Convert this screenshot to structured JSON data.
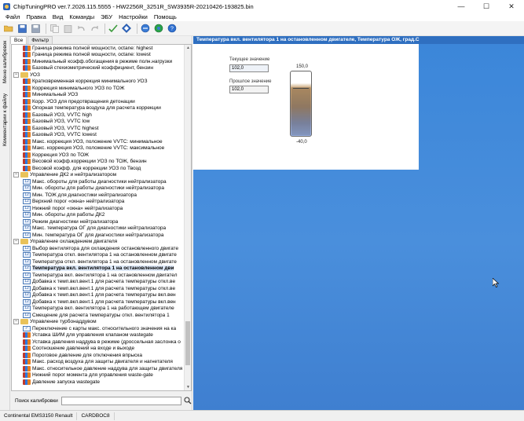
{
  "window": {
    "title": "ChipTuningPRO ver.7.2026.115.5555 - HW2256R_3251R_SW3935R-20210426-193825.bin",
    "minimize_glyph": "—",
    "maximize_glyph": "☐",
    "close_glyph": "✕"
  },
  "menu": [
    "Файл",
    "Правка",
    "Вид",
    "Команды",
    "ЭБУ",
    "Настройки",
    "Помощь"
  ],
  "toolbar": {
    "icons": [
      "open-folder-icon",
      "save-icon",
      "save-as-icon",
      "copy-icon",
      "paste-icon",
      "undo-icon",
      "redo-icon",
      "checksum-icon",
      "navigate-icon",
      "connect-icon",
      "world-icon",
      "help-icon"
    ]
  },
  "left_rail": {
    "tabs": [
      "Меню калибровок",
      "Комментарии к файлу"
    ]
  },
  "tree": {
    "tabs": [
      "Все",
      "Фильтр"
    ],
    "rows": [
      {
        "type": "map",
        "level": 2,
        "label": "Граница режима полной мощности, octane: highest"
      },
      {
        "type": "map",
        "level": 2,
        "label": "Граница режима полной мощности, octane: lowest"
      },
      {
        "type": "map",
        "level": 2,
        "label": "Минимальный коэфф.обогащения в режиме полн.нагрузки"
      },
      {
        "type": "map",
        "level": 2,
        "label": "Базовый стехиометрический коэффициент, бензин"
      },
      {
        "type": "folder",
        "level": 0,
        "label": "УОЗ",
        "exp": "−"
      },
      {
        "type": "map",
        "level": 2,
        "label": "Кратковременная коррекция минимального УОЗ"
      },
      {
        "type": "map",
        "level": 2,
        "label": "Коррекция минимального УОЗ по ТОЖ"
      },
      {
        "type": "map",
        "level": 2,
        "label": "Минимальный УОЗ"
      },
      {
        "type": "map",
        "level": 2,
        "label": "Корр. УОЗ для предотвращения детонации"
      },
      {
        "type": "map",
        "level": 2,
        "label": "Опорная температура воздуха для расчета коррекции"
      },
      {
        "type": "map",
        "level": 2,
        "label": "Базовый УОЗ, VVTC high"
      },
      {
        "type": "map",
        "level": 2,
        "label": "Базовый УОЗ, VVTC low"
      },
      {
        "type": "map",
        "level": 2,
        "label": "Базовый УОЗ, VVTC highest"
      },
      {
        "type": "map",
        "level": 2,
        "label": "Базовый УОЗ, VVTC lowest"
      },
      {
        "type": "map",
        "level": 2,
        "label": "Макс. коррекция УОЗ, положение VVTC: минимальное"
      },
      {
        "type": "map",
        "level": 2,
        "label": "Макс. коррекция УОЗ, положение VVTC: максимальное"
      },
      {
        "type": "map",
        "level": 2,
        "label": "Коррекция УОЗ по ТОЖ"
      },
      {
        "type": "map",
        "level": 2,
        "label": "Весовой коэфф.коррекции УОЗ по ТОЖ, бензин"
      },
      {
        "type": "map",
        "level": 2,
        "label": "Весовой коэфф. для коррекции УОЗ по Твозд"
      },
      {
        "type": "folder",
        "level": 0,
        "label": "Управление ДК2 и нейтрализатором",
        "exp": "−"
      },
      {
        "type": "val",
        "level": 2,
        "label": "Макс. обороты для работы диагностики нейтрализатора"
      },
      {
        "type": "val",
        "level": 2,
        "label": "Мин. обороты для работы диагностики нейтрализатора"
      },
      {
        "type": "val",
        "level": 2,
        "label": "Мин. ТОЖ для диагностики нейтрализатора"
      },
      {
        "type": "val",
        "level": 2,
        "label": "Верхний порог «окна» нейтрализатора"
      },
      {
        "type": "val",
        "level": 2,
        "label": "Нижний порог «окна» нейтрализатора"
      },
      {
        "type": "val",
        "level": 2,
        "label": "Мин. обороты для работы ДК2"
      },
      {
        "type": "val",
        "level": 2,
        "label": "Режим диагностики нейтрализатора"
      },
      {
        "type": "val",
        "level": 2,
        "label": "Макс. температура ОГ для диагностики нейтрализатора"
      },
      {
        "type": "val",
        "level": 2,
        "label": "Мин. температура ОГ для диагностики нейтрализатора"
      },
      {
        "type": "folder",
        "level": 0,
        "label": "Управление охлаждением двигателя",
        "exp": "−"
      },
      {
        "type": "val",
        "level": 2,
        "label": "Выбор вентилятора для охлаждения остановленного двигате"
      },
      {
        "type": "val",
        "level": 2,
        "label": "Температура откл. вентилятора 1 на остановленном двигате"
      },
      {
        "type": "val",
        "level": 2,
        "label": "Температура откл. вентилятора 1 на остановленном двигате"
      },
      {
        "type": "val",
        "level": 2,
        "label": "Температура вкл. вентилятора 1 на остановленном дви",
        "selected": true
      },
      {
        "type": "val",
        "level": 2,
        "label": "Температура вкл. вентилятора 1 на остановленном двигател"
      },
      {
        "type": "val",
        "level": 2,
        "label": "Добавка к темп.вкл.вент.1 для расчета температуры откл.ве"
      },
      {
        "type": "val",
        "level": 2,
        "label": "Добавка к темп.вкл.вент.1 для расчета температуры откл.ве"
      },
      {
        "type": "val",
        "level": 2,
        "label": "Добавка к темп.вкл.вент.1 для расчета температуры вкл.вен"
      },
      {
        "type": "val",
        "level": 2,
        "label": "Добавка к темп.вкл.вент.1 для расчета температуры вкл.вен"
      },
      {
        "type": "val",
        "level": 2,
        "label": "Температура вкл. вентилятора 1 на работающем двигателе"
      },
      {
        "type": "val",
        "level": 2,
        "label": "Смещение для расчета температуры откл. вентилятора 1"
      },
      {
        "type": "folder",
        "level": 0,
        "label": "Управление турбонаддувом",
        "exp": "−"
      },
      {
        "type": "check",
        "level": 2,
        "label": "Переключение с карты макс. относительного значения на ка"
      },
      {
        "type": "map",
        "level": 2,
        "label": "Уставка ШИМ для управления клапаном wastegate"
      },
      {
        "type": "map",
        "level": 2,
        "label": "Уставка давления наддува в режиме (дроссельная заслонка о"
      },
      {
        "type": "map",
        "level": 2,
        "label": "Соотношение давлений на входе и выходе"
      },
      {
        "type": "map",
        "level": 2,
        "label": "Пороговое давление для отключения впрыска"
      },
      {
        "type": "map",
        "level": 2,
        "label": "Макс. расход воздуха для защиты двигателя и нагнетателя"
      },
      {
        "type": "map",
        "level": 2,
        "label": "Макс. относительное давление наддува для защиты двигателя"
      },
      {
        "type": "map",
        "level": 2,
        "label": "Нижний порог момента для управления waste-gate"
      },
      {
        "type": "map",
        "level": 2,
        "label": "Давление запуска wastegate"
      }
    ]
  },
  "search": {
    "label": "Поиск калибровки",
    "value": "",
    "placeholder": ""
  },
  "main": {
    "header": "Температура вкл. вентилятора 1 на остановленном двигателе, Температура ОЖ, град.С",
    "current_label": "Текущее значение",
    "current_value": "102,0",
    "previous_label": "Прошлое значение",
    "previous_value": "102,0",
    "gauge_max": "150,0",
    "gauge_min": "-40,0",
    "gauge_value": 102.0
  },
  "status": {
    "ecu": "Continental EMS3150 Renault",
    "cardbox": "CARDBOC8"
  },
  "colors": {
    "workspace": "#3b86d9",
    "header_bar": "#2f6fc0",
    "selection": "#dde8f7"
  }
}
